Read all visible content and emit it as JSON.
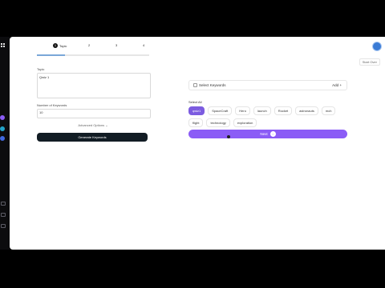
{
  "header": {
    "start_over": "Start Over"
  },
  "steps": {
    "step1_num": "1",
    "step1_label": "Topic",
    "step2": "2",
    "step3": "3",
    "step4": "4"
  },
  "progress": {
    "value": 0.25
  },
  "form": {
    "topic_label": "Topic",
    "topic_value": "Qwiz 1",
    "num_label": "Number of Keywords",
    "num_value": "10",
    "advanced": "Advanced Options ⌄",
    "generate": "Generate Keywords"
  },
  "keywords": {
    "select_label": "Select Keywords",
    "add_label": "Add +"
  },
  "select_all": "Select All",
  "chips": [
    "qwiz1",
    "SpaceCraft",
    "Hero",
    "launch",
    "Rocket",
    "astronauts",
    "mch",
    "flight",
    "technology",
    "exploration"
  ],
  "next": {
    "label": "Next",
    "icon": "arrow-right-icon"
  },
  "colors": {
    "accent": "#8b5cf6",
    "dark_button": "#121c24"
  }
}
